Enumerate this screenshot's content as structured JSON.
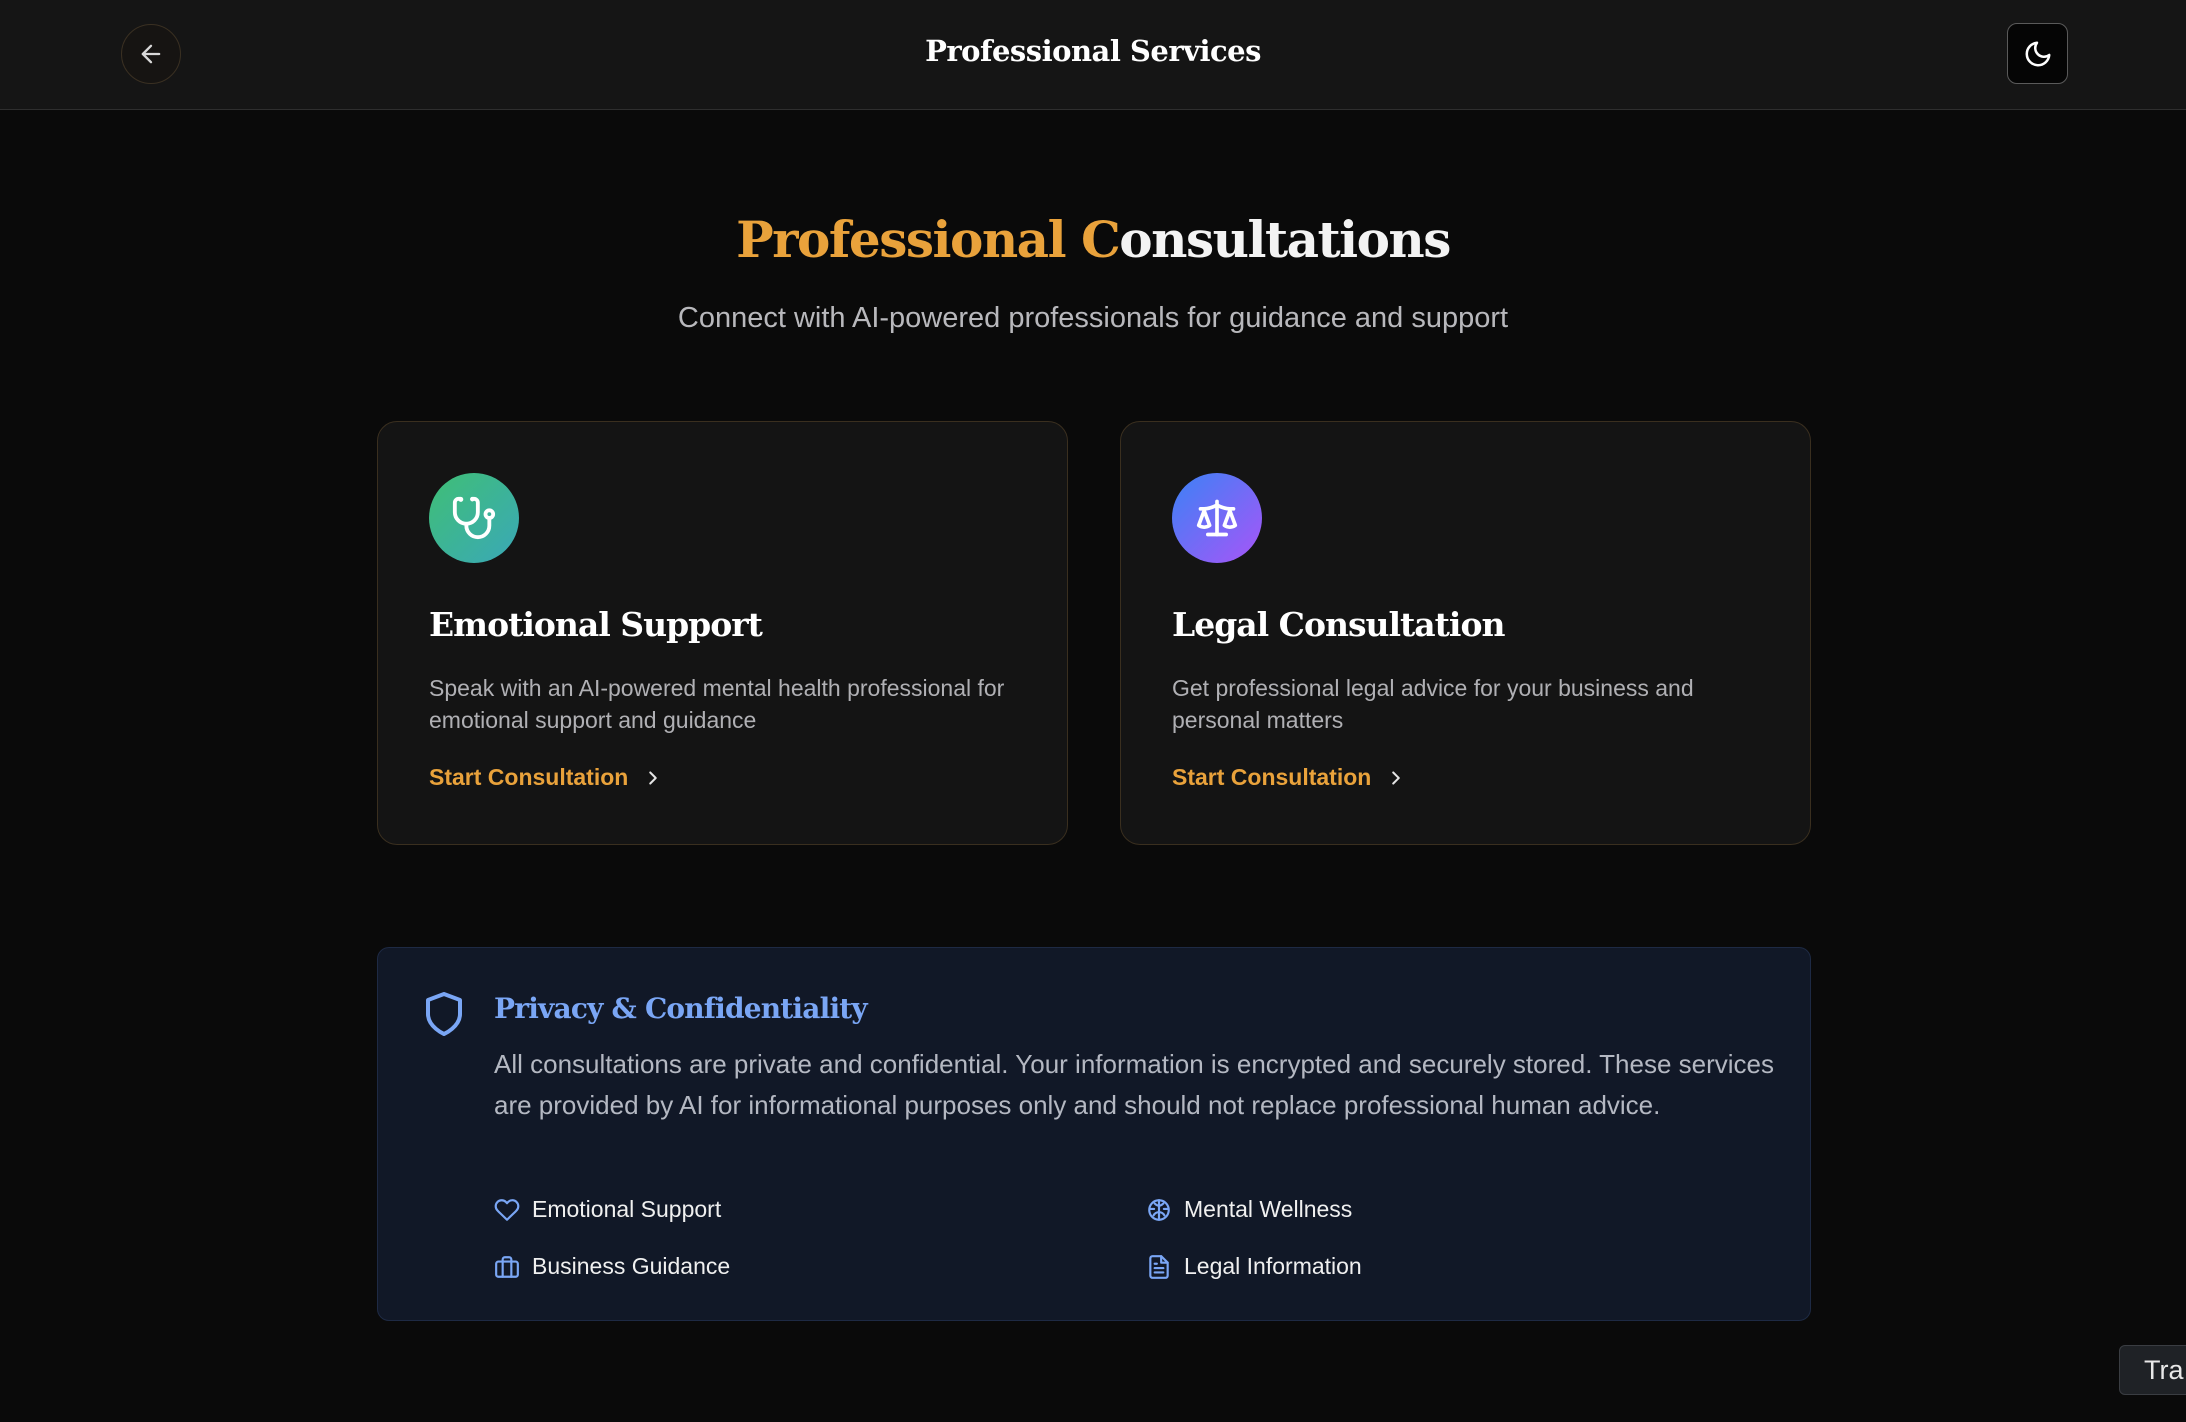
{
  "header": {
    "title": "Professional Services",
    "back_icon": "arrow-left-icon",
    "theme_icon": "moon-icon"
  },
  "hero": {
    "title_accent": "Professional C",
    "title_rest": "onsultations",
    "subtitle": "Connect with AI-powered professionals for guidance and support"
  },
  "cards": [
    {
      "icon": "stethoscope-icon",
      "title": "Emotional Support",
      "description": "Speak with an AI-powered mental health professional for emotional support and guidance",
      "link": "Start Consultation"
    },
    {
      "icon": "scale-icon",
      "title": "Legal Consultation",
      "description": "Get professional legal advice for your business and personal matters",
      "link": "Start Consultation"
    }
  ],
  "privacy": {
    "icon": "shield-icon",
    "title": "Privacy & Confidentiality",
    "text": "All consultations are private and confidential. Your information is encrypted and securely stored. These services are provided by AI for informational purposes only and should not replace professional human advice.",
    "features": [
      {
        "icon": "heart-icon",
        "label": "Emotional Support"
      },
      {
        "icon": "brain-icon",
        "label": "Mental Wellness"
      },
      {
        "icon": "briefcase-icon",
        "label": "Business Guidance"
      },
      {
        "icon": "document-icon",
        "label": "Legal Information"
      }
    ]
  },
  "tooltip": {
    "text": "Tra"
  },
  "colors": {
    "accent": "#e9a23b",
    "privacy_blue": "#7aa6f5",
    "background": "#0a0a0a"
  }
}
